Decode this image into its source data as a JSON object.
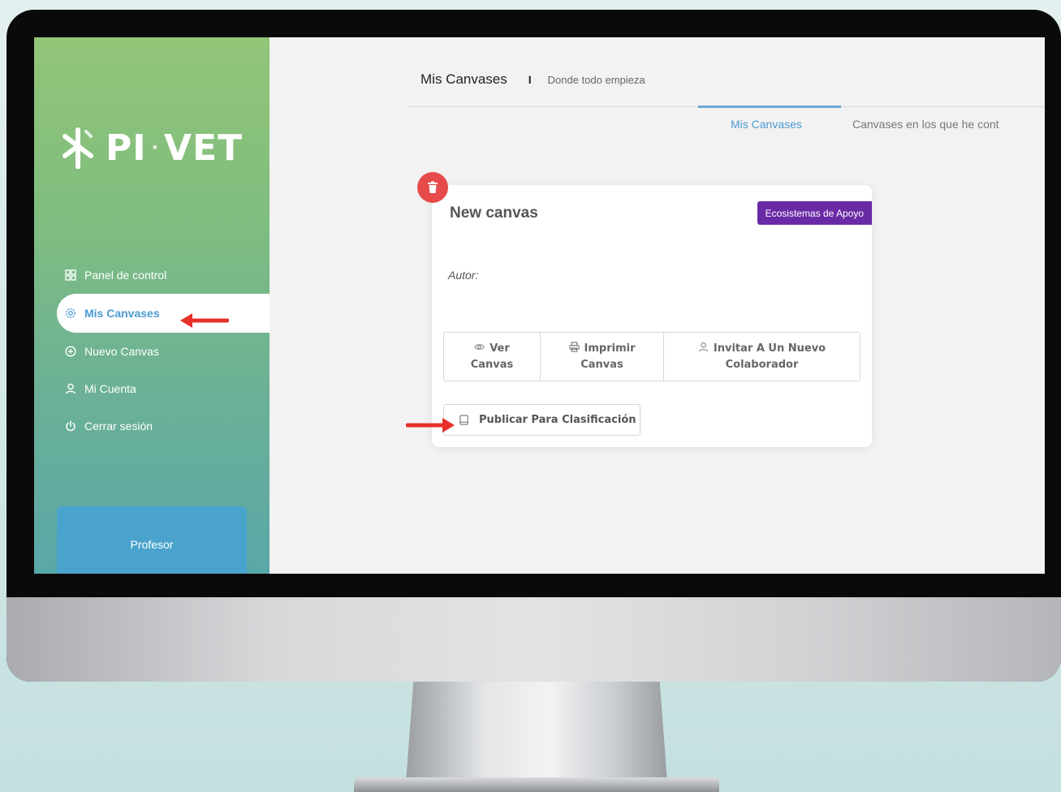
{
  "app": {
    "logo_text_left": "PI",
    "logo_text_right": "VET",
    "logo_separator": "·"
  },
  "sidebar": {
    "items": [
      {
        "label": "Panel de control",
        "icon": "grid-icon",
        "active": false
      },
      {
        "label": "Mis Canvases",
        "icon": "gear-icon",
        "active": true
      },
      {
        "label": "Nuevo Canvas",
        "icon": "plus-circle-icon",
        "active": false
      },
      {
        "label": "Mi Cuenta",
        "icon": "user-icon",
        "active": false
      },
      {
        "label": "Cerrar sesión",
        "icon": "power-icon",
        "active": false
      }
    ],
    "role": "Profesor"
  },
  "header": {
    "title": "Mis Canvases",
    "separator": "I",
    "subtitle": "Donde todo empieza"
  },
  "tabs": [
    {
      "label": "Mis Canvases",
      "active": true
    },
    {
      "label": "Canvases en los que he cont",
      "active": false
    }
  ],
  "card": {
    "title": "New canvas",
    "badge": "Ecosistemas de Apoyo",
    "author_label": "Autor:",
    "actions": [
      {
        "icon": "eye-icon",
        "line1": "Ver",
        "line2": "Canvas"
      },
      {
        "icon": "printer-icon",
        "line1": "Imprimir",
        "line2": "Canvas"
      },
      {
        "icon": "user-icon",
        "line1": "Invitar A Un Nuevo",
        "line2": "Colaborador"
      }
    ],
    "publish_label": "Publicar Para Clasificación"
  },
  "colors": {
    "accent_blue": "#4b9bd0",
    "badge_purple": "#6a2aa6",
    "delete_red": "#e74a4a",
    "annotation_red": "#e8302a",
    "sidebar_top": "#92c577",
    "sidebar_bottom": "#5aa7a8"
  }
}
